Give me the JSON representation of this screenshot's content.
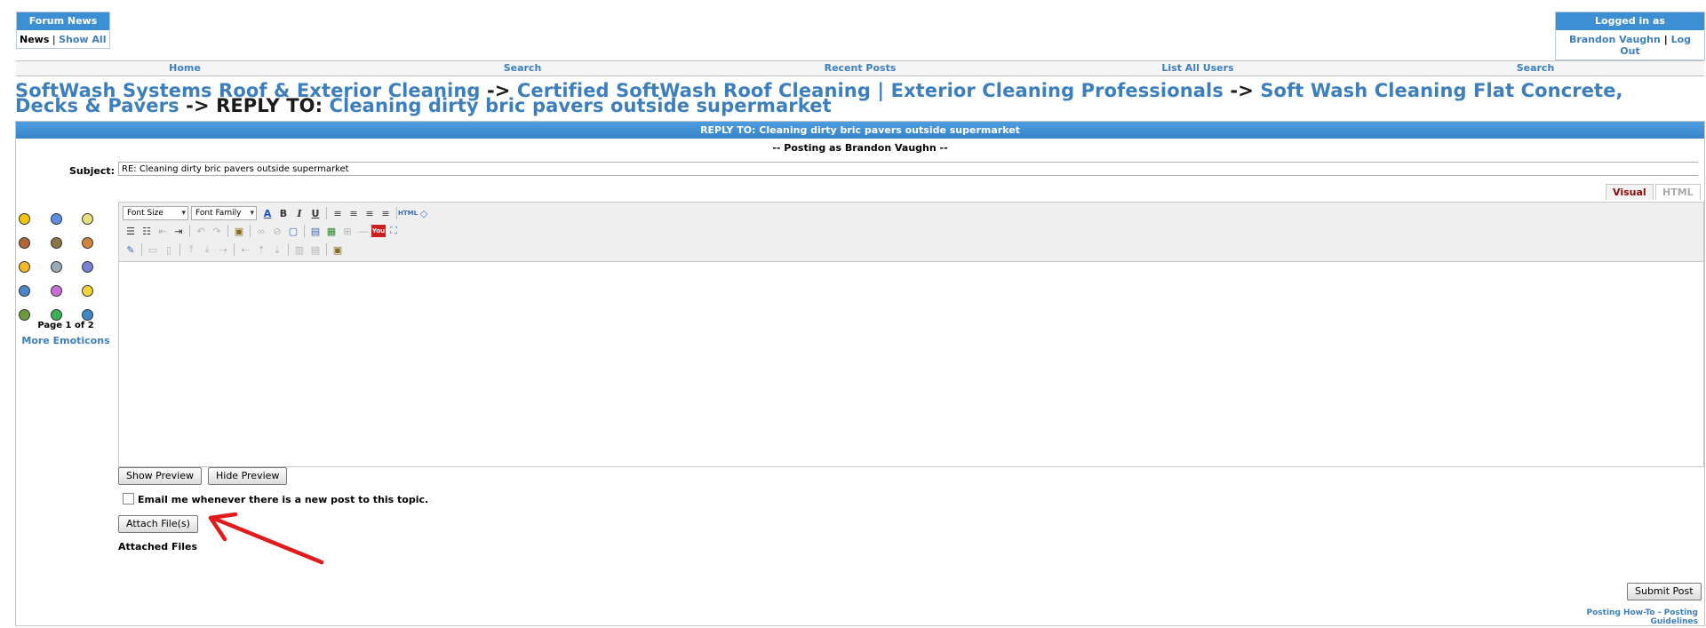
{
  "news_box": {
    "title": "Forum News",
    "news_label": "News",
    "separator": "|",
    "show_all": "Show All"
  },
  "login_box": {
    "title": "Logged in as",
    "user": "Brandon Vaughn",
    "separator": "|",
    "logout": "Log Out"
  },
  "nav": {
    "items": [
      "Home",
      "Search",
      "Recent Posts",
      "List All Users",
      "Search"
    ]
  },
  "breadcrumb": {
    "crumb1": "SoftWash Systems Roof & Exterior Cleaning",
    "arrow": "->",
    "crumb2": "Certified SoftWash Roof Cleaning | Exterior Cleaning Professionals",
    "crumb3": "Soft Wash Cleaning Flat Concrete, Decks & Pavers",
    "reply_prefix": "REPLY TO:",
    "crumb4": "Cleaning dirty bric pavers outside supermarket"
  },
  "panel": {
    "title": "REPLY TO: Cleaning dirty bric pavers outside supermarket",
    "posting_as": "-- Posting as Brandon Vaughn --"
  },
  "subject": {
    "label": "Subject:",
    "value": "RE: Cleaning dirty bric pavers outside supermarket"
  },
  "tabs": {
    "visual": "Visual",
    "html": "HTML"
  },
  "toolbar": {
    "font_size": "Font Size",
    "font_family": "Font Family"
  },
  "emoticons": {
    "page_info": "Page 1 of 2",
    "more": "More Emoticons"
  },
  "buttons": {
    "show_preview": "Show Preview",
    "hide_preview": "Hide Preview",
    "attach": "Attach File(s)",
    "submit": "Submit Post"
  },
  "email_option": {
    "label": "Email me whenever there is a new post to this topic.",
    "checked": false
  },
  "attached_files_label": "Attached Files",
  "footer": {
    "howto": "Posting How-To",
    "dash": " - ",
    "guidelines": "Posting Guidelines"
  },
  "colors": {
    "accent": "#3d8fd4",
    "link": "#3d7fbd",
    "visual_tab": "#8b0a0a",
    "annotation": "#e01b1b"
  }
}
